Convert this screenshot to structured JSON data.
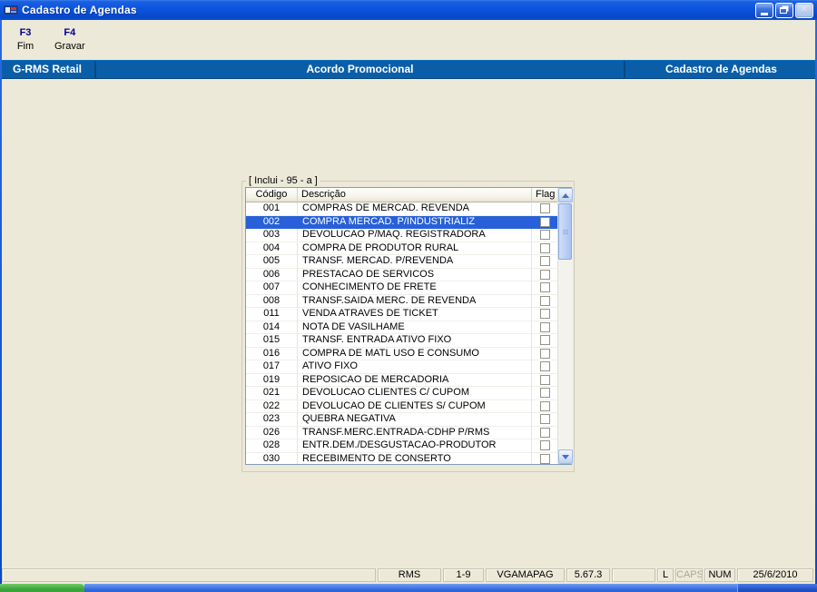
{
  "window": {
    "title": "Cadastro de Agendas"
  },
  "toolbar": {
    "buttons": [
      {
        "key": "F3",
        "label": "Fim"
      },
      {
        "key": "F4",
        "label": "Gravar"
      }
    ]
  },
  "breadcrumb": {
    "left": "G-RMS Retail",
    "center": "Acordo Promocional",
    "right": "Cadastro de Agendas"
  },
  "groupbox": {
    "label": "[ Inclui - 95 - a  ]"
  },
  "grid": {
    "columns": [
      "Código",
      "Descrição",
      "Flag"
    ],
    "selected_code": "002",
    "rows": [
      {
        "code": "001",
        "desc": "COMPRAS DE MERCAD. REVENDA",
        "flag": false
      },
      {
        "code": "002",
        "desc": "COMPRA MERCAD. P/INDUSTRIALIZ",
        "flag": false
      },
      {
        "code": "003",
        "desc": "DEVOLUCAO P/MAQ. REGISTRADORA",
        "flag": false
      },
      {
        "code": "004",
        "desc": "COMPRA DE PRODUTOR RURAL",
        "flag": false
      },
      {
        "code": "005",
        "desc": "TRANSF. MERCAD. P/REVENDA",
        "flag": false
      },
      {
        "code": "006",
        "desc": "PRESTACAO DE SERVICOS",
        "flag": false
      },
      {
        "code": "007",
        "desc": "CONHECIMENTO DE FRETE",
        "flag": false
      },
      {
        "code": "008",
        "desc": "TRANSF.SAIDA MERC. DE REVENDA",
        "flag": false
      },
      {
        "code": "011",
        "desc": "VENDA ATRAVES DE TICKET",
        "flag": false
      },
      {
        "code": "014",
        "desc": "NOTA DE VASILHAME",
        "flag": false
      },
      {
        "code": "015",
        "desc": "TRANSF. ENTRADA ATIVO FIXO",
        "flag": false
      },
      {
        "code": "016",
        "desc": "COMPRA DE MATL USO E CONSUMO",
        "flag": false
      },
      {
        "code": "017",
        "desc": "ATIVO FIXO",
        "flag": false
      },
      {
        "code": "019",
        "desc": "REPOSICAO DE MERCADORIA",
        "flag": false
      },
      {
        "code": "021",
        "desc": "DEVOLUCAO CLIENTES C/ CUPOM",
        "flag": false
      },
      {
        "code": "022",
        "desc": "DEVOLUCAO DE CLIENTES S/ CUPOM",
        "flag": false
      },
      {
        "code": "023",
        "desc": "QUEBRA NEGATIVA",
        "flag": false
      },
      {
        "code": "026",
        "desc": "TRANSF.MERC.ENTRADA-CDHP P/RMS",
        "flag": false
      },
      {
        "code": "028",
        "desc": "ENTR.DEM./DESGUSTACAO-PRODUTOR",
        "flag": false
      },
      {
        "code": "030",
        "desc": "RECEBIMENTO DE CONSERTO",
        "flag": false
      }
    ]
  },
  "statusbar": {
    "cells": [
      "",
      "RMS",
      "1-9",
      "VGAMAPAG",
      "5.67.3",
      "",
      "L",
      "CAPS",
      "NUM",
      "25/6/2010"
    ]
  },
  "colors": {
    "titlebar_blue": "#0A55DE",
    "band_blue": "#0A5EA8",
    "selection_blue": "#2760D8",
    "chrome_gray": "#ECE9D8",
    "taskbar_blue": "#2C64DC",
    "start_green": "#3AA33A"
  }
}
